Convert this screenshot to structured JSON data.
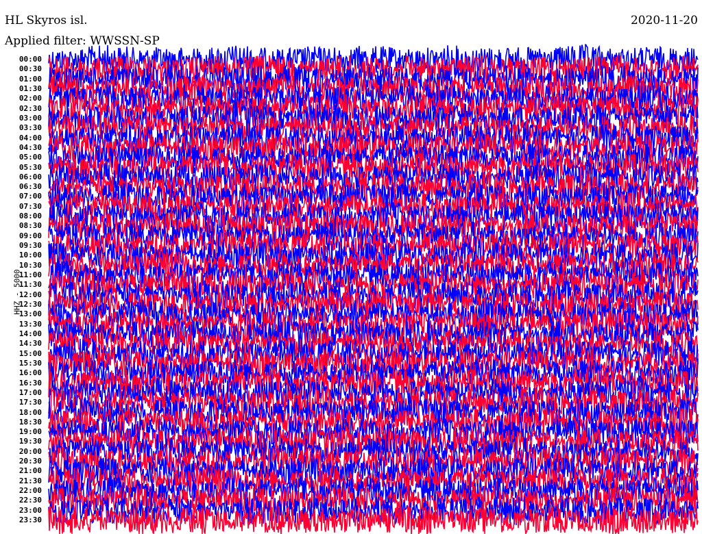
{
  "header": {
    "station": "HL Skyros isl.",
    "date": "2020-11-20",
    "filter": "Applied filter: WWSSN-SP"
  },
  "chart_data": {
    "type": "line",
    "subtype": "helicorder",
    "ylabel": "HHZ - 5000",
    "row_labels": [
      "00:00",
      "00:30",
      "01:00",
      "01:30",
      "02:00",
      "02:30",
      "03:00",
      "03:30",
      "04:00",
      "04:30",
      "05:00",
      "05:30",
      "06:00",
      "06:30",
      "07:00",
      "07:30",
      "08:00",
      "08:30",
      "09:00",
      "09:30",
      "10:00",
      "10:30",
      "11:00",
      "11:30",
      "12:00",
      "12:30",
      "13:00",
      "13:30",
      "14:00",
      "14:30",
      "15:00",
      "15:30",
      "16:00",
      "16:30",
      "17:00",
      "17:30",
      "18:00",
      "18:30",
      "19:00",
      "19:30",
      "20:00",
      "20:30",
      "21:00",
      "21:30",
      "22:00",
      "22:30",
      "23:00",
      "23:30"
    ],
    "trace_colors": [
      "#0000ff",
      "#ff0033"
    ],
    "grid": false
  }
}
